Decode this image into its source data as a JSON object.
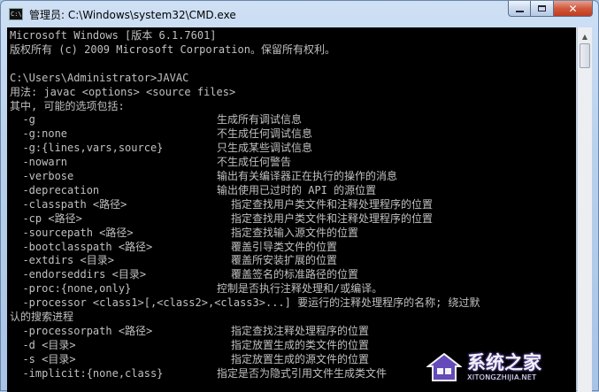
{
  "window": {
    "title": "管理员: C:\\Windows\\system32\\CMD.exe",
    "icon_label": "C:\\",
    "buttons": {
      "minimize": "minimize",
      "maximize": "maximize",
      "close": "✕"
    }
  },
  "console": {
    "lines": [
      {
        "text": "Microsoft Windows [版本 6.1.7601]"
      },
      {
        "text": "版权所有 (c) 2009 Microsoft Corporation。保留所有权利。"
      },
      {
        "text": ""
      },
      {
        "text": "C:\\Users\\Administrator>JAVAC"
      },
      {
        "text": "用法: javac <options> <source files>"
      },
      {
        "text": "其中, 可能的选项包括:"
      },
      {
        "opt": "  -g",
        "desc": "生成所有调试信息"
      },
      {
        "opt": "  -g:none",
        "desc": "不生成任何调试信息"
      },
      {
        "opt": "  -g:{lines,vars,source}",
        "desc": "只生成某些调试信息"
      },
      {
        "opt": "  -nowarn",
        "desc": "不生成任何警告"
      },
      {
        "opt": "  -verbose",
        "desc": "输出有关编译器正在执行的操作的消息"
      },
      {
        "opt": "  -deprecation",
        "desc": "输出使用已过时的 API 的源位置"
      },
      {
        "opt": "  -classpath <路径>",
        "desc": "指定查找用户类文件和注释处理程序的位置",
        "wide": true
      },
      {
        "opt": "  -cp <路径>",
        "desc": "指定查找用户类文件和注释处理程序的位置",
        "wide": true
      },
      {
        "opt": "  -sourcepath <路径>",
        "desc": "指定查找输入源文件的位置",
        "wide": true
      },
      {
        "opt": "  -bootclasspath <路径>",
        "desc": "覆盖引导类文件的位置",
        "wide": true
      },
      {
        "opt": "  -extdirs <目录>",
        "desc": "覆盖所安装扩展的位置",
        "wide": true
      },
      {
        "opt": "  -endorseddirs <目录>",
        "desc": "覆盖签名的标准路径的位置",
        "wide": true
      },
      {
        "opt": "  -proc:{none,only}",
        "desc": "控制是否执行注释处理和/或编译。"
      },
      {
        "text": "  -processor <class1>[,<class2>,<class3>...] 要运行的注释处理程序的名称; 绕过默"
      },
      {
        "text": "认的搜索进程"
      },
      {
        "opt": "  -processorpath <路径>",
        "desc": "指定查找注释处理程序的位置",
        "wide": true
      },
      {
        "opt": "  -d <目录>",
        "desc": "指定放置生成的类文件的位置",
        "wide": true
      },
      {
        "opt": "  -s <目录>",
        "desc": "指定放置生成的源文件的位置",
        "wide": true
      },
      {
        "opt": "  -implicit:{none,class}",
        "desc": "指定是否为隐式引用文件生成类文件"
      }
    ]
  },
  "scrollbar": {
    "up_arrow": "▲"
  },
  "watermark": {
    "logo_text": "系统之家",
    "url_text": "XITONGZHIJIA.NET"
  },
  "colors": {
    "console_bg": "#000000",
    "console_text": "#c0c0c0",
    "close_button": "#c94a2e",
    "window_frame": "#b8d0ec"
  }
}
